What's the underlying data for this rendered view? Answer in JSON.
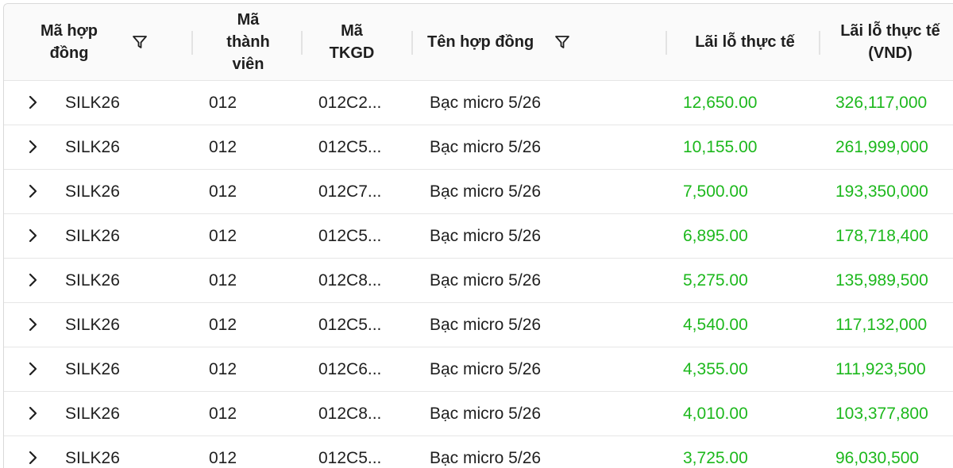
{
  "columns": {
    "ma_hop_dong": "Mã hợp đồng",
    "ma_thanh_vien": "Mã thành viên",
    "ma_tkgd": "Mã TKGD",
    "ten_hop_dong": "Tên hợp đồng",
    "lai_lo_thuc_te": "Lãi lỗ thực tế",
    "lai_lo_thuc_te_vnd": "Lãi lỗ thực tế (VND)"
  },
  "icons": {
    "filter": "filter-icon",
    "expand": "chevron-right-icon"
  },
  "colors": {
    "profit": "#1db81d",
    "header_bg": "#fafafa",
    "border": "#e6e6e6"
  },
  "rows": [
    {
      "contract": "SILK26",
      "member": "012",
      "account": "012C2...",
      "name": "Bạc micro 5/26",
      "pnl": "12,650.00",
      "pnl_vnd": "326,117,000"
    },
    {
      "contract": "SILK26",
      "member": "012",
      "account": "012C5...",
      "name": "Bạc micro 5/26",
      "pnl": "10,155.00",
      "pnl_vnd": "261,999,000"
    },
    {
      "contract": "SILK26",
      "member": "012",
      "account": "012C7...",
      "name": "Bạc micro 5/26",
      "pnl": "7,500.00",
      "pnl_vnd": "193,350,000"
    },
    {
      "contract": "SILK26",
      "member": "012",
      "account": "012C5...",
      "name": "Bạc micro 5/26",
      "pnl": "6,895.00",
      "pnl_vnd": "178,718,400"
    },
    {
      "contract": "SILK26",
      "member": "012",
      "account": "012C8...",
      "name": "Bạc micro 5/26",
      "pnl": "5,275.00",
      "pnl_vnd": "135,989,500"
    },
    {
      "contract": "SILK26",
      "member": "012",
      "account": "012C5...",
      "name": "Bạc micro 5/26",
      "pnl": "4,540.00",
      "pnl_vnd": "117,132,000"
    },
    {
      "contract": "SILK26",
      "member": "012",
      "account": "012C6...",
      "name": "Bạc micro 5/26",
      "pnl": "4,355.00",
      "pnl_vnd": "111,923,500"
    },
    {
      "contract": "SILK26",
      "member": "012",
      "account": "012C8...",
      "name": "Bạc micro 5/26",
      "pnl": "4,010.00",
      "pnl_vnd": "103,377,800"
    },
    {
      "contract": "SILK26",
      "member": "012",
      "account": "012C5...",
      "name": "Bạc micro 5/26",
      "pnl": "3,725.00",
      "pnl_vnd": "96,030,500"
    }
  ]
}
